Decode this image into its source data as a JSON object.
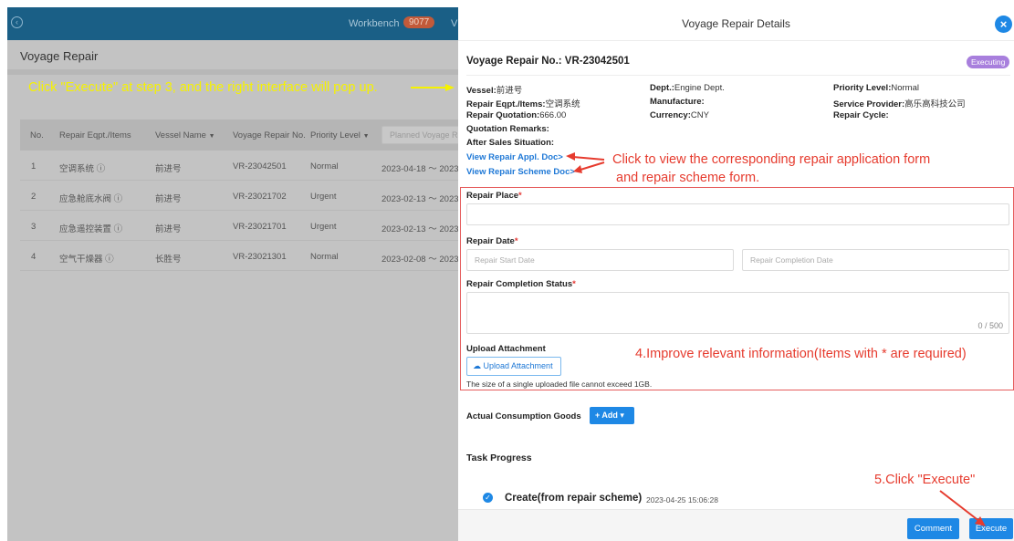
{
  "left_page": {
    "workbench_label": "Workbench",
    "workbench_count": "9077",
    "workbench_cut": "V",
    "page_title": "Voyage Repair",
    "step_note": "Click \"Execute\" at step 3, and the right interface will pop up.",
    "table": {
      "headers": [
        "No.",
        "Repair Eqpt./Items",
        "Vessel Name",
        "Voyage Repair No.",
        "Priority Level"
      ],
      "search_placeholder": "Planned Voyage Re",
      "rows": [
        {
          "no": "1",
          "item": "空调系统 ⓘ",
          "vessel": "前进号",
          "repair_no": "VR-23042501",
          "priority": "Normal",
          "date": "2023-04-18 ～ 2023"
        },
        {
          "no": "2",
          "item": "应急舱底水阀 ⓘ",
          "vessel": "前进号",
          "repair_no": "VR-23021702",
          "priority": "Urgent",
          "date": "2023-02-13 ～ 2023"
        },
        {
          "no": "3",
          "item": "应急遥控装置 ⓘ",
          "vessel": "前进号",
          "repair_no": "VR-23021701",
          "priority": "Urgent",
          "date": "2023-02-13 ～ 2023"
        },
        {
          "no": "4",
          "item": "空气干燥器 ⓘ",
          "vessel": "长胜号",
          "repair_no": "VR-23021301",
          "priority": "Normal",
          "date": "2023-02-08 ～ 2023"
        }
      ]
    }
  },
  "drawer": {
    "title": "Voyage Repair Details",
    "repair_no_label": "Voyage Repair No.:",
    "repair_no_value": "VR-23042501",
    "status": "Executing",
    "info": {
      "vessel_label": "Vessel:",
      "vessel_value": "前进号",
      "dept_label": "Dept.:",
      "dept_value": "Engine Dept.",
      "priority_label": "Priority Level:",
      "priority_value": "Normal",
      "eqpt_label": "Repair Eqpt./Items:",
      "eqpt_value": "空调系统",
      "manufacture_label": "Manufacture:",
      "provider_label": "Service Provider:",
      "provider_value": "高乐高科技公司",
      "quotation_label": "Repair Quotation:",
      "quotation_value": "666.00",
      "currency_label": "Currency:",
      "currency_value": "CNY",
      "cycle_label": "Repair Cycle:",
      "remarks_label": "Quotation Remarks:",
      "aftersales_label": "After Sales Situation:"
    },
    "links": {
      "appl_doc": "View Repair Appl. Doc>",
      "scheme_doc": "View Repair Scheme Doc>"
    },
    "annotations": {
      "view_note_line1": "Click to view the corresponding repair application form",
      "view_note_line2": "and repair scheme form.",
      "improve_note": "4.Improve relevant information(Items with * are required)",
      "execute_note": "5.Click \"Execute\""
    },
    "form": {
      "repair_place_label": "Repair Place",
      "repair_date_label": "Repair Date",
      "start_date_placeholder": "Repair Start Date",
      "completion_date_placeholder": "Repair Completion Date",
      "completion_status_label": "Repair Completion Status",
      "char_count": "0 / 500",
      "required_mark": "*",
      "upload_label": "Upload Attachment",
      "upload_button": "Upload Attachment",
      "upload_note": "The size of a single uploaded file cannot exceed 1GB."
    },
    "consumption": {
      "label": "Actual Consumption Goods",
      "add_button": "+ Add ▾"
    },
    "task_progress": {
      "title": "Task Progress",
      "item_title": "Create(from repair scheme)",
      "item_time": "2023-04-25 15:06:28"
    },
    "footer": {
      "comment_button": "Comment",
      "execute_button": "Execute"
    }
  },
  "colors": {
    "primary": "#1e88e5",
    "status_badge": "#a87fdd",
    "annotation_red": "#e63b2e",
    "annotation_yellow": "#f6f200",
    "topbar": "#1a5f86"
  }
}
